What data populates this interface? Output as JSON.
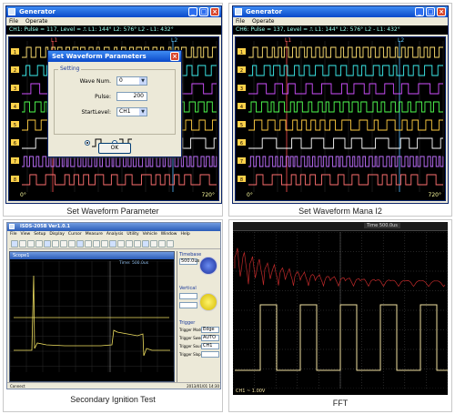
{
  "captions": {
    "tl": "Set Waveform Parameter",
    "tr": "Set Waveform Mana I2",
    "bl": "Secondary Ignition Test",
    "br": "FFT"
  },
  "gen1": {
    "title": "Generator",
    "menu": [
      "File",
      "Operate"
    ],
    "status": "CH1: Pulse = 117, Level = ⎍    L1: 144°  L2: 576°  L2 - L1: 432°",
    "cursor1": "L1",
    "cursor2": "L2",
    "axis_start": "0°",
    "axis_end": "720°",
    "channels": [
      "1",
      "2",
      "3",
      "4",
      "5",
      "6",
      "7",
      "8"
    ]
  },
  "dialog": {
    "title": "Set Waveform Parameters",
    "group": "Setting",
    "wave_num_label": "Wave Num.",
    "wave_num_value": "0",
    "pulse_label": "Pulse:",
    "pulse_value": "200",
    "start_level_label": "StartLevel:",
    "start_level_value": "CH1",
    "ok_label": "OK"
  },
  "gen2": {
    "title": "Generator",
    "menu": [
      "File",
      "Operate"
    ],
    "status": "CH6: Pulse = 137, Level = ⎍    L1: 144°  L2: 576°  L2 - L1: 432°",
    "cursor1": "L1",
    "cursor2": "L2",
    "axis_start": "0°",
    "axis_end": "720°",
    "channels": [
      "1",
      "2",
      "3",
      "4",
      "5",
      "6",
      "7",
      "8"
    ]
  },
  "scope3": {
    "title": "ISDS-205B Ver1.0.1",
    "menu": [
      "File",
      "View",
      "Setup",
      "Display",
      "Cursor",
      "Measure",
      "Analysis",
      "Utility",
      "Vehicle",
      "Window",
      "Help"
    ],
    "inner_title": "Scope1",
    "time_label": "Time: 500.0us",
    "side": {
      "timebase_label": "Timebase",
      "timebase_value": "500.0us",
      "vertical_label": "Vertical",
      "trigger_label": "Trigger",
      "trigger_mode_label": "Trigger Mode",
      "trigger_mode_value": "Edge",
      "trigger_sweep_label": "Trigger Sweep",
      "trigger_sweep_value": "AUTO",
      "trigger_source_label": "Trigger Source",
      "trigger_source_value": "CH1",
      "trigger_slope_label": "Trigger Slope"
    },
    "status_left": "Connect",
    "status_right": "2013/01/01  14:30"
  },
  "fft": {
    "time_label": "Time 500.0us",
    "ch_label": "CH1 ~ 1.00V",
    "colors": {
      "waveform": "#f0e0a0",
      "fft": "#c02a2a",
      "grid": "#4a4a4a"
    }
  }
}
